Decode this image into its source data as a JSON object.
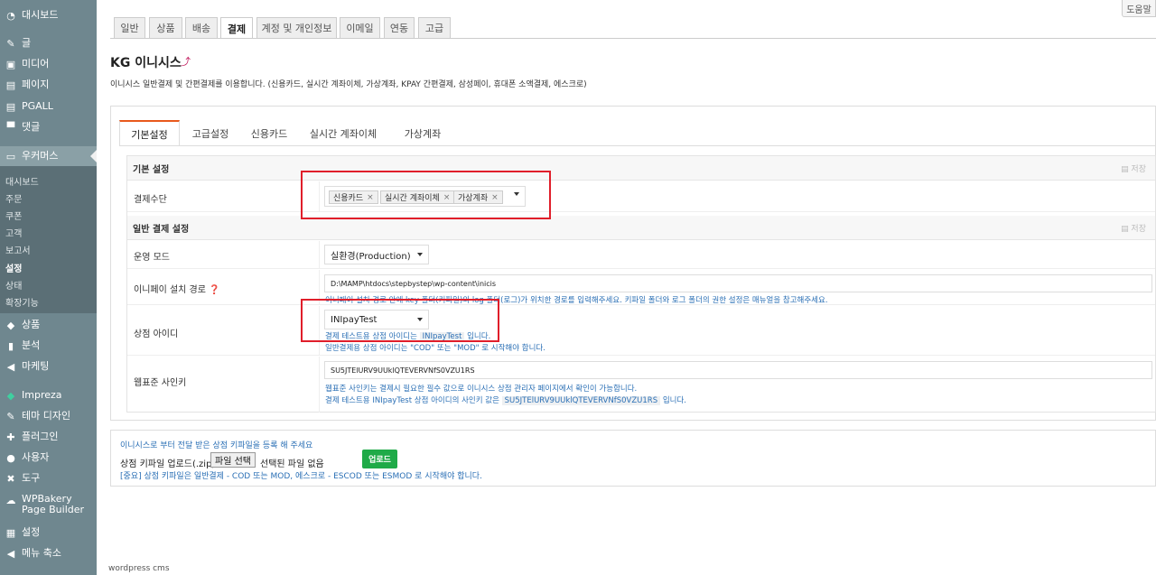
{
  "sidebar": {
    "items": [
      {
        "label": "대시보드",
        "icon": "dashboard-icon",
        "glyph": "◔"
      },
      {
        "label": "글",
        "icon": "pin-icon",
        "glyph": "✎"
      },
      {
        "label": "미디어",
        "icon": "media-icon",
        "glyph": "▣"
      },
      {
        "label": "페이지",
        "icon": "page-icon",
        "glyph": "▤"
      },
      {
        "label": "PGALL",
        "icon": "document-icon",
        "glyph": "▤"
      },
      {
        "label": "댓글",
        "icon": "comment-icon",
        "glyph": "▀"
      },
      {
        "label": "우커머스",
        "icon": "woo-icon",
        "glyph": "▭"
      },
      {
        "label": "상품",
        "icon": "box-icon",
        "glyph": "◆"
      },
      {
        "label": "분석",
        "icon": "chart-icon",
        "glyph": "▮"
      },
      {
        "label": "마케팅",
        "icon": "megaphone-icon",
        "glyph": "◀"
      },
      {
        "label": "Impreza",
        "icon": "diamond-icon",
        "glyph": "◆"
      },
      {
        "label": "테마 디자인",
        "icon": "brush-icon",
        "glyph": "✎"
      },
      {
        "label": "플러그인",
        "icon": "plugin-icon",
        "glyph": "✚"
      },
      {
        "label": "사용자",
        "icon": "user-icon",
        "glyph": "●"
      },
      {
        "label": "도구",
        "icon": "wrench-icon",
        "glyph": "✖"
      },
      {
        "label": "WPBakery Page Builder",
        "icon": "cloud-icon",
        "glyph": "☁"
      },
      {
        "label": "설정",
        "icon": "settings-icon",
        "glyph": "▦"
      },
      {
        "label": "메뉴 축소",
        "icon": "collapse-icon",
        "glyph": "◀"
      }
    ],
    "submenu": [
      "대시보드",
      "주문",
      "쿠폰",
      "고객",
      "보고서",
      "설정",
      "상태",
      "확장기능"
    ]
  },
  "help_button": "도움말",
  "top_tabs": [
    "일반",
    "상품",
    "배송",
    "결제",
    "계정 및 개인정보",
    "이메일",
    "연동",
    "고급"
  ],
  "page": {
    "title": "KG 이니시스",
    "title_link": "⤴",
    "description": "이니시스 일반결제 및 간편결제를 이용합니다. (신용카드, 실시간 계좌이체, 가상계좌, KPAY 간편결제, 삼성페이, 휴대폰 소액결제, 에스크로)"
  },
  "sub_tabs": [
    "기본설정",
    "고급설정",
    "신용카드",
    "실시간 계좌이체",
    "가상계좌"
  ],
  "section_basic": {
    "heading": "기본 설정",
    "save": "▤ 저장",
    "payment_label": "결제수단",
    "payment_methods": [
      "신용카드",
      "실시간 계좌이체",
      "가상계좌"
    ]
  },
  "section_general": {
    "heading": "일반 결제 설정",
    "save": "▤ 저장",
    "mode_label": "운영 모드",
    "mode_value": "실환경(Production)",
    "path_label": "이니페이 설치 경로",
    "path_value": "D:\\MAMP\\htdocs\\stepbystep\\wp-content\\inicis",
    "path_help": "이니페이 설치 경로 안에 key 폴더(키파일)와 log 폴더(로그)가 위치한 경로를 입력해주세요. 키파일 폴더와 로그 폴더의 권한 설정은 매뉴얼을 참고해주세요.",
    "merchant_label": "상점 아이디",
    "merchant_value": "INIpayTest",
    "merchant_help_1": "결제 테스트용 상점 아이디는",
    "merchant_help_code": "INIpayTest",
    "merchant_help_2": "입니다.",
    "merchant_help_3": "일반결제용 상점 아이디는 \"COD\" 또는 \"MOD\" 로 시작해야 합니다.",
    "signkey_label": "웹표준 사인키",
    "signkey_value": "SU5JTElURV9UUklQTEVERVNfS0VZU1RS",
    "signkey_help_1": "웹표준 사인키는 결제시 필요한 필수 값으로 이니시스 상점 관리자 페이지에서 확인이 가능합니다.",
    "signkey_help_2": "결제 테스트용 INIpayTest 상점 아이디의 사인키 값은",
    "signkey_help_code": "SU5JTElURV9UUklQTEVERVNfS0VZU1RS",
    "signkey_help_3": "입니다."
  },
  "upload": {
    "note": "이니시스로 부터 전달 받은 상점 키파일을 등록 해 주세요",
    "label": "상점 키파일 업로드(.zip) :",
    "file_button": "파일 선택",
    "file_status": "선택된 파일 없음",
    "upload_button": "업로드",
    "warning": "[중요] 상점 키파일은 일반결제 - COD 또는 MOD, 에스크로 - ESCOD 또는 ESMOD 로 시작해야 합니다."
  },
  "footer": "wordpress cms",
  "colors": {
    "sidebar": "#6f878f",
    "accent_tab": "#e8591c",
    "highlight": "#e01e2a",
    "link": "#2a6fb5",
    "upload_button": "#1faa48"
  }
}
